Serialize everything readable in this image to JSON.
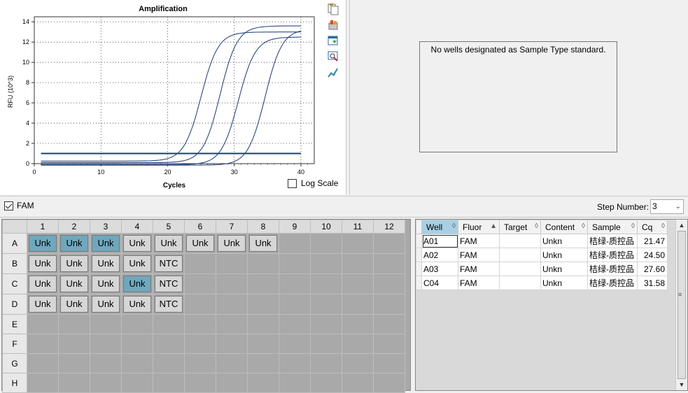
{
  "chart": {
    "title": "Amplification",
    "xlabel": "Cycles",
    "ylabel": "RFU (10^3)",
    "log_scale_label": "Log Scale",
    "log_scale_checked": false
  },
  "chart_data": {
    "type": "line",
    "title": "Amplification",
    "xlabel": "Cycles",
    "ylabel": "RFU (10^3)",
    "xlim": [
      0,
      42
    ],
    "ylim": [
      0,
      14.5
    ],
    "x_ticks": [
      0,
      10,
      20,
      30,
      40
    ],
    "y_ticks": [
      0,
      2,
      4,
      6,
      8,
      10,
      12,
      14
    ],
    "grid": true,
    "threshold": 1.0,
    "series": [
      {
        "well": "A01",
        "cq": 21.47,
        "plateau": 13.0,
        "baseline": 0.25
      },
      {
        "well": "A02",
        "cq": 24.5,
        "plateau": 13.6,
        "baseline": 0.1
      },
      {
        "well": "A03",
        "cq": 27.6,
        "plateau": 12.5,
        "baseline": -0.1
      },
      {
        "well": "C04",
        "cq": 31.58,
        "plateau": 13.3,
        "baseline": -0.15
      }
    ],
    "line_color": "#2a4a80",
    "threshold_color": "#1b3f6e"
  },
  "standard": {
    "message": "No wells designated as Sample Type standard."
  },
  "strip": {
    "fluor_label": "FAM",
    "fluor_checked": true,
    "step_label": "Step Number:",
    "step_value": "3"
  },
  "plate": {
    "columns": [
      "1",
      "2",
      "3",
      "4",
      "5",
      "6",
      "7",
      "8",
      "9",
      "10",
      "11",
      "12"
    ],
    "rows": [
      {
        "label": "A",
        "wells": [
          "Unk",
          "Unk",
          "Unk",
          "Unk",
          "Unk",
          "Unk",
          "Unk",
          "Unk",
          "",
          "",
          "",
          ""
        ],
        "selected": [
          0,
          1,
          2
        ]
      },
      {
        "label": "B",
        "wells": [
          "Unk",
          "Unk",
          "Unk",
          "Unk",
          "NTC",
          "",
          "",
          "",
          "",
          "",
          "",
          ""
        ],
        "selected": []
      },
      {
        "label": "C",
        "wells": [
          "Unk",
          "Unk",
          "Unk",
          "Unk",
          "NTC",
          "",
          "",
          "",
          "",
          "",
          "",
          ""
        ],
        "selected": [
          3
        ]
      },
      {
        "label": "D",
        "wells": [
          "Unk",
          "Unk",
          "Unk",
          "Unk",
          "NTC",
          "",
          "",
          "",
          "",
          "",
          "",
          ""
        ],
        "selected": []
      },
      {
        "label": "E",
        "wells": [
          "",
          "",
          "",
          "",
          "",
          "",
          "",
          "",
          "",
          "",
          "",
          ""
        ],
        "selected": []
      },
      {
        "label": "F",
        "wells": [
          "",
          "",
          "",
          "",
          "",
          "",
          "",
          "",
          "",
          "",
          "",
          ""
        ],
        "selected": []
      },
      {
        "label": "G",
        "wells": [
          "",
          "",
          "",
          "",
          "",
          "",
          "",
          "",
          "",
          "",
          "",
          ""
        ],
        "selected": []
      },
      {
        "label": "H",
        "wells": [
          "",
          "",
          "",
          "",
          "",
          "",
          "",
          "",
          "",
          "",
          "",
          ""
        ],
        "selected": []
      }
    ],
    "selected_color": "#6fa8bd"
  },
  "results": {
    "headers": [
      "Well",
      "Fluor",
      "Target",
      "Content",
      "Sample",
      "Cq"
    ],
    "sort_glyphs": [
      "◊",
      "▲",
      "◊",
      "◊",
      "◊",
      "◊"
    ],
    "rows": [
      [
        "A01",
        "FAM",
        "",
        "Unkn",
        "桔绿-质控品",
        "21.47"
      ],
      [
        "A02",
        "FAM",
        "",
        "Unkn",
        "桔绿-质控品",
        "24.50"
      ],
      [
        "A03",
        "FAM",
        "",
        "Unkn",
        "桔绿-质控品",
        "27.60"
      ],
      [
        "C04",
        "FAM",
        "",
        "Unkn",
        "桔绿-质控品",
        "31.58"
      ]
    ]
  },
  "icons": [
    "copy-icon",
    "export-icon",
    "save-image-icon",
    "zoom-icon",
    "curve-settings-icon"
  ]
}
